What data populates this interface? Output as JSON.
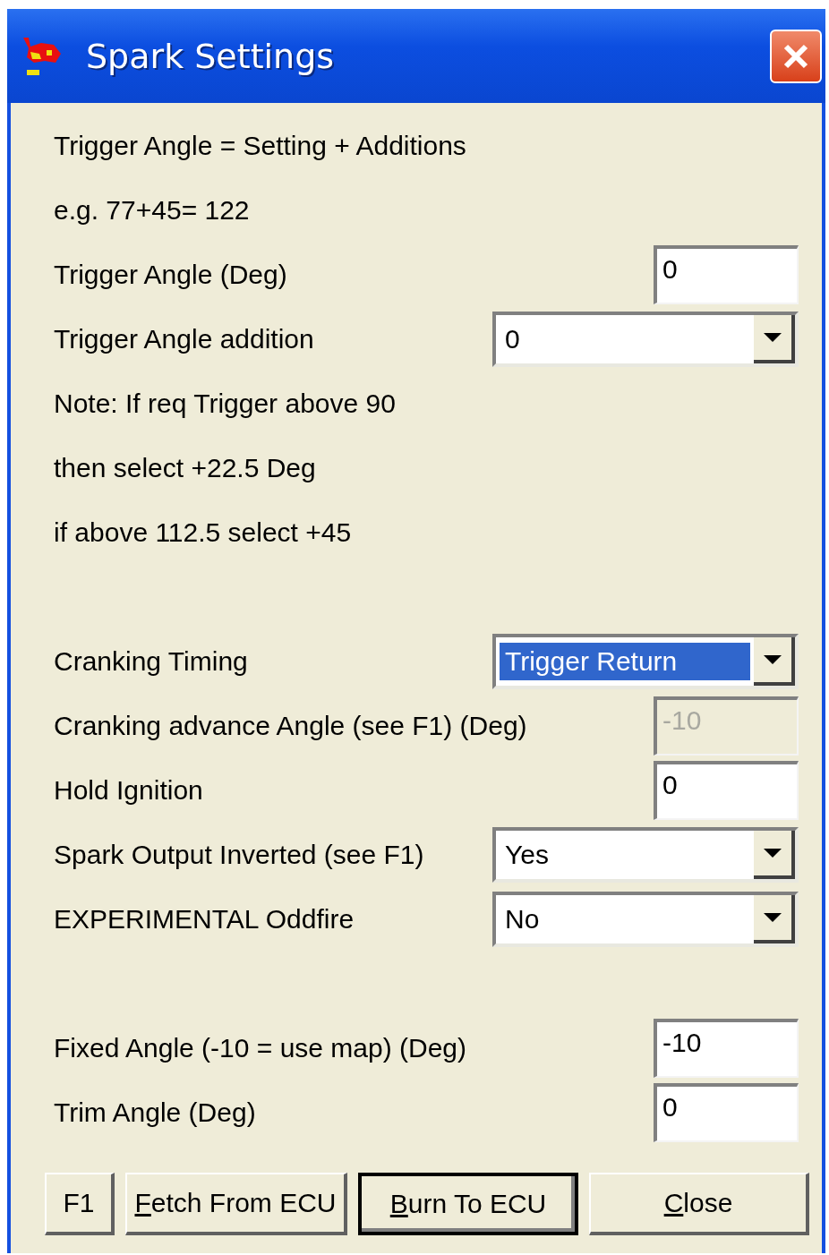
{
  "window": {
    "title": "Spark Settings"
  },
  "sections": [
    {
      "rows": [
        {
          "kind": "text",
          "label": "Trigger Angle = Setting + Additions"
        },
        {
          "kind": "text",
          "label": "e.g. 77+45= 122"
        },
        {
          "kind": "number",
          "label": "Trigger Angle  (Deg)",
          "value": "0",
          "disabled": false
        },
        {
          "kind": "select",
          "label": "Trigger Angle addition",
          "value": "0",
          "highlighted": false
        },
        {
          "kind": "text",
          "label": "Note: If req Trigger above 90"
        },
        {
          "kind": "text",
          "label": "then select +22.5 Deg"
        },
        {
          "kind": "text",
          "label": "if above 112.5 select +45"
        }
      ]
    },
    {
      "rows": [
        {
          "kind": "select",
          "label": "Cranking Timing",
          "value": "Trigger Return",
          "highlighted": true
        },
        {
          "kind": "number",
          "label": "Cranking advance Angle (see F1) (Deg)",
          "value": "-10",
          "disabled": true
        },
        {
          "kind": "number",
          "label": "Hold Ignition",
          "value": "0",
          "disabled": false
        },
        {
          "kind": "select",
          "label": "Spark Output Inverted (see F1)",
          "value": "Yes",
          "highlighted": false
        },
        {
          "kind": "select",
          "label": "EXPERIMENTAL Oddfire",
          "value": "No",
          "highlighted": false
        }
      ]
    },
    {
      "rows": [
        {
          "kind": "number",
          "label": "Fixed Angle (-10 = use map) (Deg)",
          "value": "-10",
          "disabled": false
        },
        {
          "kind": "number",
          "label": "Trim Angle (Deg)",
          "value": "0",
          "disabled": false
        }
      ]
    }
  ],
  "buttons": [
    {
      "label": "F1",
      "underline_first": false,
      "default": false
    },
    {
      "label": "Fetch From ECU",
      "underline_first": true,
      "default": false
    },
    {
      "label": "Burn To ECU",
      "underline_first": true,
      "default": true
    },
    {
      "label": "Close",
      "underline_first": true,
      "default": false
    }
  ]
}
